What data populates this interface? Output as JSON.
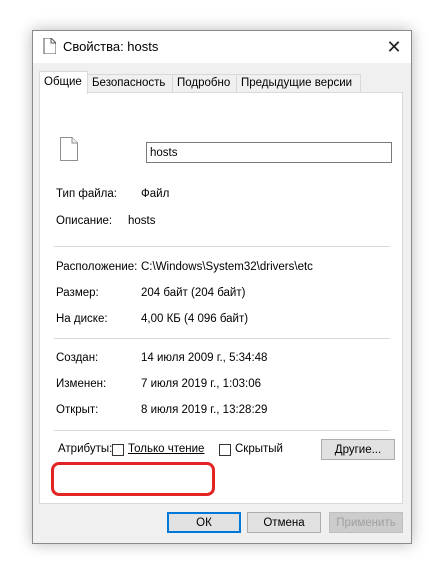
{
  "window": {
    "title": "Свойства: hosts",
    "close_glyph": "✕"
  },
  "tabs": [
    {
      "label": "Общие",
      "active": true
    },
    {
      "label": "Безопасность",
      "active": false
    },
    {
      "label": "Подробно",
      "active": false
    },
    {
      "label": "Предыдущие версии",
      "active": false
    }
  ],
  "general": {
    "file_name": "hosts",
    "type_label": "Тип файла:",
    "type_value": "Файл",
    "description_label": "Описание:",
    "description_value": "hosts",
    "location_label": "Расположение:",
    "location_value": "C:\\Windows\\System32\\drivers\\etc",
    "size_label": "Размер:",
    "size_value": "204 байт (204 байт)",
    "disk_size_label": "На диске:",
    "disk_size_value": "4,00 КБ (4 096 байт)",
    "created_label": "Создан:",
    "created_value": "14 июля 2009 г., 5:34:48",
    "modified_label": "Изменен:",
    "modified_value": "7 июля 2019 г., 1:03:06",
    "opened_label": "Открыт:",
    "opened_value": "8 июля 2019 г., 13:28:29"
  },
  "attributes": {
    "label": "Атрибуты:",
    "readonly_label": "Только чтение",
    "readonly_checked": false,
    "hidden_label": "Скрытый",
    "hidden_checked": false,
    "other_button": "Другие..."
  },
  "footer": {
    "ok": "ОК",
    "cancel": "Отмена",
    "apply": "Применить"
  },
  "colors": {
    "highlight": "#e32424",
    "default_button_border": "#0078d7"
  },
  "icons": [
    "file-icon",
    "close-icon"
  ]
}
